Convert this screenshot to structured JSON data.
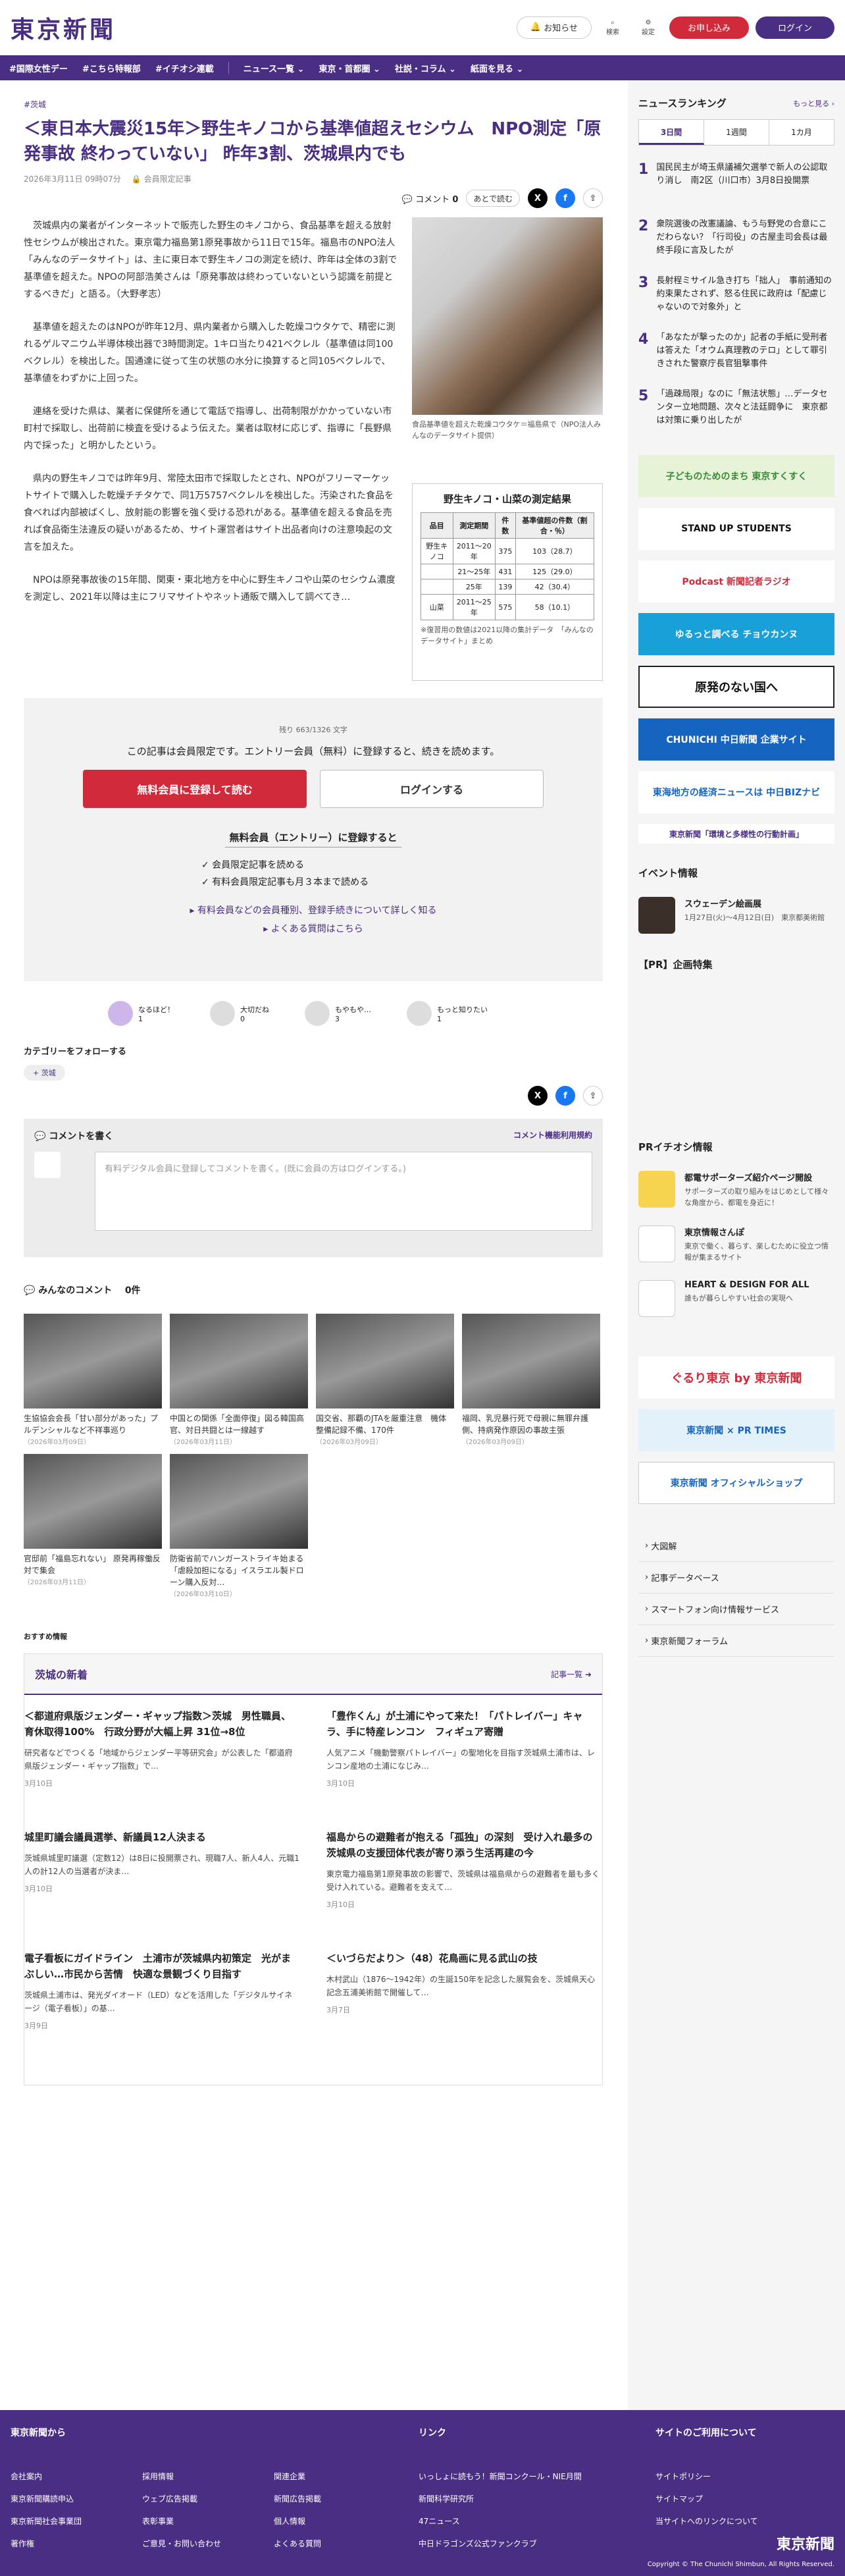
{
  "header": {
    "logo": "東京新聞",
    "notify": "お知らせ",
    "search": "検索",
    "settings": "設定",
    "apply": "お申し込み",
    "login": "ログイン"
  },
  "nav": [
    "#国際女性デー",
    "#こちら特報部",
    "#イチオシ連載",
    "ニュース一覧 ⌄",
    "東京・首都圏 ⌄",
    "社説・コラム ⌄",
    "紙面を見る ⌄"
  ],
  "article": {
    "crumb": "#茨城",
    "title": "＜東日本大震災15年＞野生キノコから基準値超えセシウム　NPO測定「原発事故 終わっていない」 昨年3割、茨城県内でも",
    "date": "2026年3月11日 09時07分",
    "member": "会員限定記事",
    "comment_label": "コメント",
    "comment_count": "0",
    "later": "あとで読む",
    "paras": [
      "茨城県内の業者がインターネットで販売した野生のキノコから、食品基準を超える放射性セシウムが検出された。東京電力福島第1原発事故から11日で15年。福島市のNPO法人「みんなのデータサイト」は、主に東日本で野生キノコの測定を続け、昨年は全体の3割で基準値を超えた。NPOの阿部浩美さんは「原発事故は終わっていないという認識を前提とするべきだ」と語る。（大野孝志）",
      "基準値を超えたのはNPOが昨年12月、県内業者から購入した乾燥コウタケで、精密に測れるゲルマニウム半導体検出器で3時間測定。1キロ当たり421ベクレル（基準値は同100ベクレル）を検出した。国通達に従って生の状態の水分に換算すると同105ベクレルで、基準値をわずかに上回った。",
      "連絡を受けた県は、業者に保健所を通じて電話で指導し、出荷制限がかかっていない市町村で採取し、出荷前に検査を受けるよう伝えた。業者は取材に応じず、指導に「長野県内で採った」と明かしたという。",
      "県内の野生キノコでは昨年9月、常陸太田市で採取したとされ、NPOがフリーマーケットサイトで購入した乾燥チチタケで、同1万5757ベクレルを検出した。汚染された食品を食べれば内部被ばくし、放射能の影響を強く受ける恐れがある。基準値を超える食品を売れば食品衛生法違反の疑いがあるため、サイト運営者はサイト出品者向けの注意喚起の文言を加えた。",
      "NPOは原発事故後の15年間、関東・東北地方を中心に野生キノコや山菜のセシウム濃度を測定し、2021年以降は主にフリマサイトやネット通販で購入して調べてき…"
    ],
    "photo_cap": "食品基準値を超えた乾燥コウタケ＝福島県で（NPO法人みんなのデータサイト提供）",
    "table": {
      "title": "野生キノコ・山菜の測定結果",
      "headers": [
        "品目",
        "測定期間",
        "件数",
        "基準値超の件数（割合・％）"
      ],
      "rows": [
        [
          "野生キノコ",
          "2011〜20年",
          "375",
          "103（28.7）"
        ],
        [
          "",
          "21〜25年",
          "431",
          "125（29.0）"
        ],
        [
          "",
          "25年",
          "139",
          "42（30.4）"
        ],
        [
          "山菜",
          "2011〜25年",
          "575",
          "58（10.1）"
        ]
      ],
      "note": "※復習用の数値は2021以降の集計データ　「みんなのデータサイト」まとめ"
    }
  },
  "paywall": {
    "remain": "残り 663/1326 文字",
    "msg": "この記事は会員限定です。エントリー会員（無料）に登録すると、続きを読めます。",
    "reg": "無料会員に登録して読む",
    "login": "ログインする",
    "benefit": "無料会員（エントリー）に登録すると",
    "b1": "✓ 会員限定記事を読める",
    "b2": "✓ 有料会員限定記事も月３本まで読める",
    "l1": "▸ 有料会員などの会員種別、登録手続きについて詳しく知る",
    "l2": "▸ よくある質問はこちら"
  },
  "reactions": [
    {
      "label": "なるほど！",
      "n": "1"
    },
    {
      "label": "大切だね",
      "n": "0"
    },
    {
      "label": "もやもや…",
      "n": "3"
    },
    {
      "label": "もっと知りたい",
      "n": "1"
    }
  ],
  "follow": {
    "label": "カテゴリーをフォローする",
    "tag": "茨城"
  },
  "comment": {
    "write": "コメントを書く",
    "rules": "コメント機能利用規約",
    "ph": "有料デジタル会員に登録してコメントを書く。(既に会員の方はログインする。)",
    "all": "みんなのコメント",
    "count": "0件"
  },
  "cards": [
    {
      "t": "生協協会会長「甘い部分があった」プルデンシャルなど不祥事巡り",
      "d": "（2026年03月09日）"
    },
    {
      "t": "中国との関係「全面停復」図る韓国高官、対日共闘とは一線越す",
      "d": "（2026年03月11日）"
    },
    {
      "t": "国交省、那覇のJTAを厳重注意　機体整備記録不備、170件",
      "d": "（2026年03月09日）"
    },
    {
      "t": "福岡、乳児暴行死で母親に無罪弁護側、持病発作原因の事故主張",
      "d": "（2026年03月09日）"
    },
    {
      "t": "官邸前「福島忘れない」 原発再稼働反対で集会",
      "d": "（2026年03月11日）"
    },
    {
      "t": "防衛省前でハンガーストライキ始まる「虐殺加担になる」イスラエル製ドローン購入反対…",
      "d": "（2026年03月10日）"
    }
  ],
  "recommend": "おすすめ情報",
  "localnews": {
    "title": "茨城の新着",
    "more": "記事一覧 ➜",
    "items": [
      {
        "h": "＜都道府県版ジェンダー・ギャップ指数＞茨城　男性職員、育休取得100%　行政分野が大幅上昇 31位→8位",
        "p": "研究者などでつくる「地域からジェンダー平等研究会」が公表した「都道府県版ジェンダー・ギャップ指数」で…",
        "d": "3月10日"
      },
      {
        "h": "「豊作くん」が土浦にやって来た！「パトレイバー」キャラ、手に特産レンコン　フィギュア寄贈",
        "p": "人気アニメ「機動警察パトレイバー」の聖地化を目指す茨城県土浦市は、レンコン産地の土浦になじみ…",
        "d": "3月10日"
      },
      {
        "h": "城里町議会議員選挙、新議員12人決まる",
        "p": "茨城県城里町議選（定数12）は8日に投開票され、現職7人、新人4人、元職1人の計12人の当選者が決ま…",
        "d": "3月10日"
      },
      {
        "h": "福島からの避難者が抱える「孤独」の深刻　受け入れ最多の茨城県の支援団体代表が寄り添う生活再建の今",
        "p": "東京電力福島第1原発事故の影響で、茨城県は福島県からの避難者を最も多く受け入れている。避難者を支えて…",
        "d": "3月10日"
      },
      {
        "h": "電子看板にガイドライン　土浦市が茨城県内初策定　光がまぶしい…市民から苦情　快適な景観づくり目指す",
        "p": "茨城県土浦市は、発光ダイオード（LED）などを活用した「デジタルサイネージ（電子看板）」の基…",
        "d": "3月9日"
      },
      {
        "h": "＜いづらだより＞（48）花鳥画に見る武山の技",
        "p": "木村武山（1876〜1942年）の生誕150年を記念した展覧会を、茨城県天心記念五浦美術館で開催して…",
        "d": "3月7日"
      }
    ]
  },
  "ranking": {
    "title": "ニュースランキング",
    "more": "もっと見る ›",
    "tabs": [
      "3日間",
      "1週間",
      "1カ月"
    ],
    "items": [
      "国民民主が埼玉県議補欠選挙で新人の公認取り消し　南2区（川口市）3月8日投開票",
      "衆院選後の改憲議論、もう与野党の合意にこだわらない？「行司役」の古屋圭司会長は最終手段に言及したが",
      "長射程ミサイル急き打ち「拙人」　事前通知の約束果たされず、怒る住民に政府は「配慮じゃないので対象外」と",
      "「あなたが撃ったのか」記者の手紙に受刑者は答えた「オウム真理教のテロ」として罪引きされた警察庁長官狙撃事件",
      "「過疎局限」なのに「無法状態」…データセンター立地問題、次々と法廷闘争に　東京都は対策に乗り出したが"
    ]
  },
  "banners": [
    "子どものためのまち 東京すくすく",
    "STAND UP STUDENTS",
    "Podcast 新聞記者ラジオ",
    "ゆるっと調べる チョウカンヌ",
    "原発のない国へ",
    "CHUNICHI 中日新聞 企業サイト",
    "東海地方の経済ニュースは 中日BIZナビ",
    "東京新聞「環境と多様性の行動計画」"
  ],
  "event": {
    "title": "イベント情報",
    "name": "スウェーデン絵画展",
    "detail": "1月27日(火)〜4月12日(日)　東京都美術館"
  },
  "pr": {
    "title": "【PR】企画特集",
    "ititle": "PRイチオシ情報",
    "items": [
      {
        "h": "都電サポーターズ紹介ページ開設",
        "p": "サポーターズの取り組みをはじめとして様々な角度から、都電を身近に！"
      },
      {
        "h": "東京情報さんぽ",
        "p": "東京で働く、暮らす、楽しむために役立つ情報が集まるサイト"
      },
      {
        "h": "HEART & DESIGN FOR ALL",
        "p": "誰もが暮らしやすい社会の実現へ"
      }
    ]
  },
  "banners2": [
    "ぐるり東京 by 東京新聞",
    "東京新聞 × PR TIMES",
    "東京新聞 オフィシャルショップ"
  ],
  "sidelinks": [
    "大図解",
    "記事データベース",
    "スマートフォン向け情報サービス",
    "東京新聞フォーラム"
  ],
  "footer": {
    "c1": "東京新聞から",
    "c1a": [
      "会社案内",
      "東京新聞購読申込",
      "東京新聞社会事業団",
      "著作権"
    ],
    "c1b": [
      "採用情報",
      "ウェブ広告掲載",
      "表彰事業",
      "ご意見・お問い合わせ"
    ],
    "c1c": [
      "関連企業",
      "新聞広告掲載",
      "個人情報",
      "よくある質問"
    ],
    "c2": "リンク",
    "c2a": [
      "いっしょに読もう！新聞コンクール・NIE月間",
      "新聞科学研究所",
      "47ニュース",
      "中日ドラゴンズ公式ファンクラブ"
    ],
    "c3": "サイトのご利用について",
    "c3a": [
      "サイトポリシー",
      "サイトマップ",
      "当サイトへのリンクについて"
    ],
    "copy": "Copyright © The Chunichi Shimbun, All Rights Reserved."
  }
}
